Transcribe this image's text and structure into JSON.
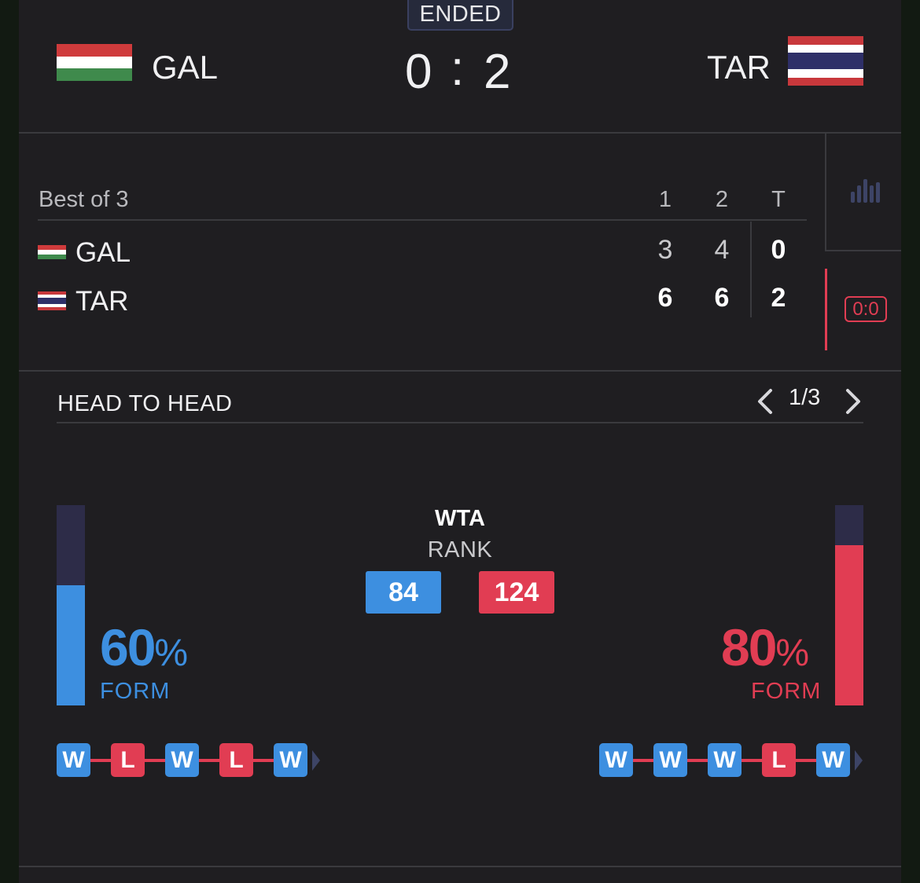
{
  "status": "ENDED",
  "header": {
    "home_team": "GAL",
    "away_team": "TAR",
    "home_score": "0",
    "separator": ":",
    "away_score": "2"
  },
  "scoreboard": {
    "format_label": "Best of 3",
    "columns": [
      "1",
      "2",
      "T"
    ],
    "rows": [
      {
        "team": "GAL",
        "set1": "3",
        "set2": "4",
        "total": "0"
      },
      {
        "team": "TAR",
        "set1": "6",
        "set2": "6",
        "total": "2"
      }
    ]
  },
  "side_tabs": {
    "scoreboard_icon_text": "0:0"
  },
  "head_to_head": {
    "title": "HEAD TO HEAD",
    "pager": "1/3",
    "ranking_org": "WTA",
    "ranking_label": "RANK",
    "home_rank": "84",
    "away_rank": "124",
    "home_form_value": "60",
    "away_form_value": "80",
    "percent_sign": "%",
    "form_label": "FORM",
    "home_form_fraction": 0.6,
    "away_form_fraction": 0.8,
    "home_streak": [
      "W",
      "L",
      "W",
      "L",
      "W"
    ],
    "away_streak": [
      "W",
      "W",
      "W",
      "L",
      "W"
    ]
  },
  "colors": {
    "home": "#3d8fe0",
    "away": "#e13d53"
  }
}
